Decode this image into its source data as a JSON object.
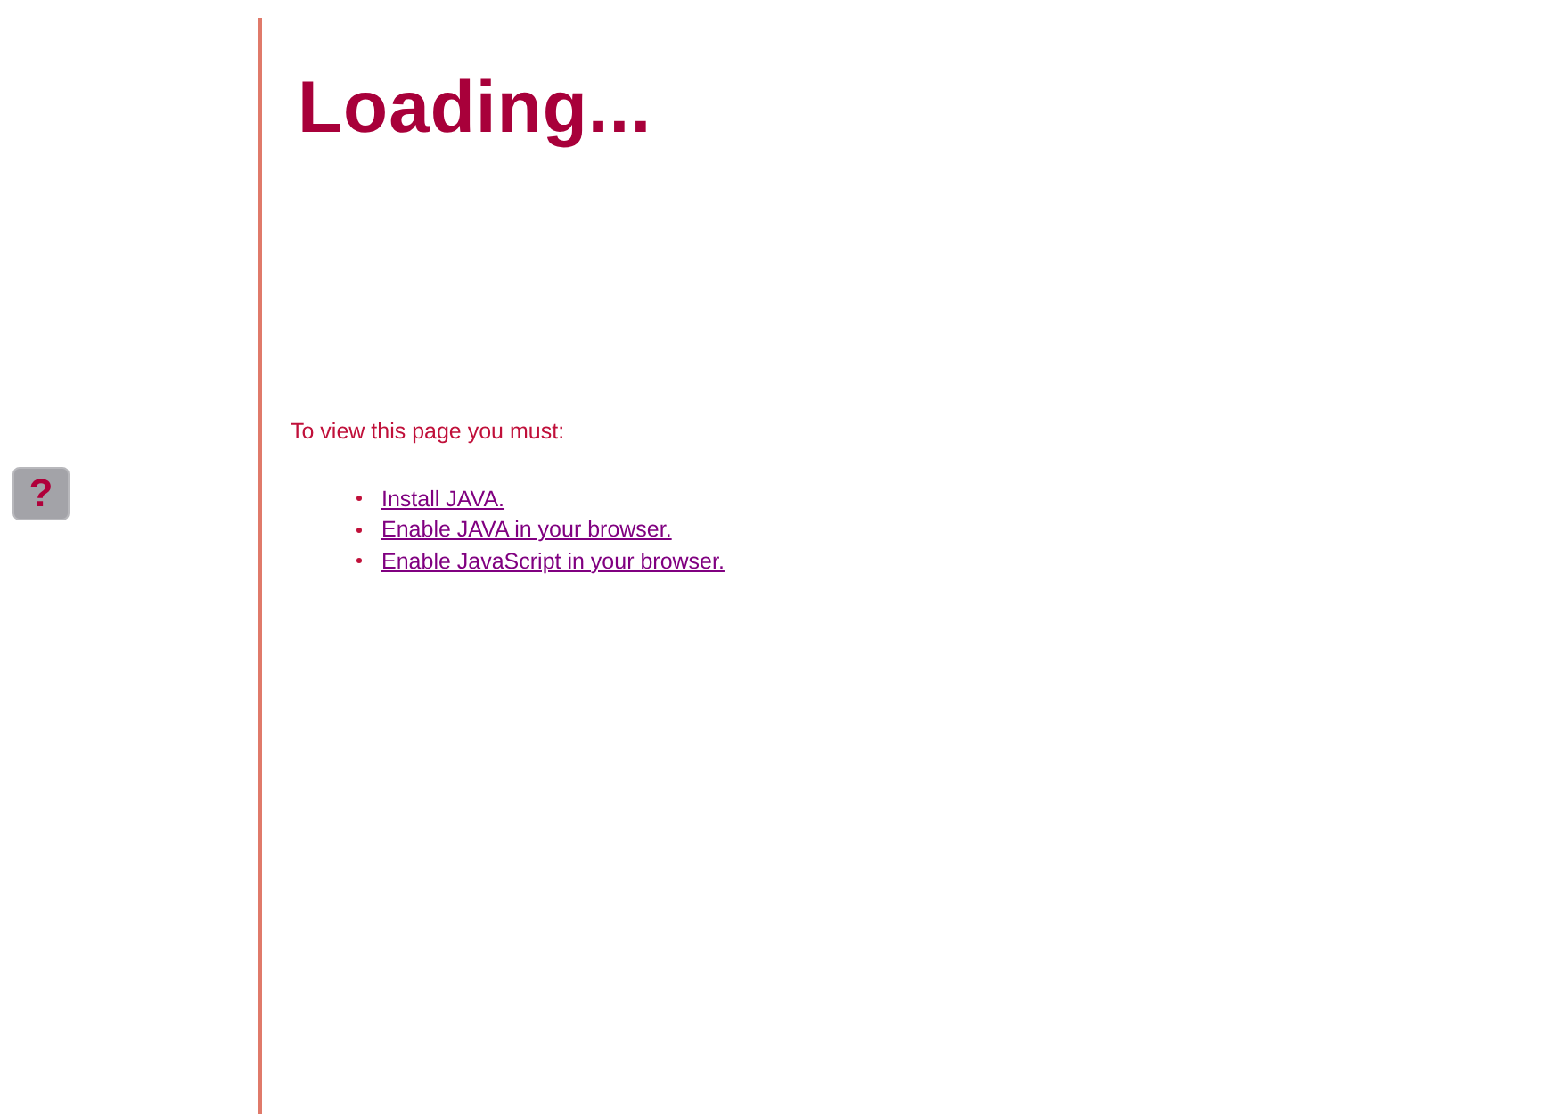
{
  "plugin_placeholder": {
    "symbol": "?"
  },
  "title": "Loading...",
  "message": "To view this page you must:",
  "requirements": [
    {
      "text": "Install JAVA."
    },
    {
      "text": "Enable JAVA in your browser."
    },
    {
      "text": "Enable JavaScript in your browser."
    }
  ]
}
